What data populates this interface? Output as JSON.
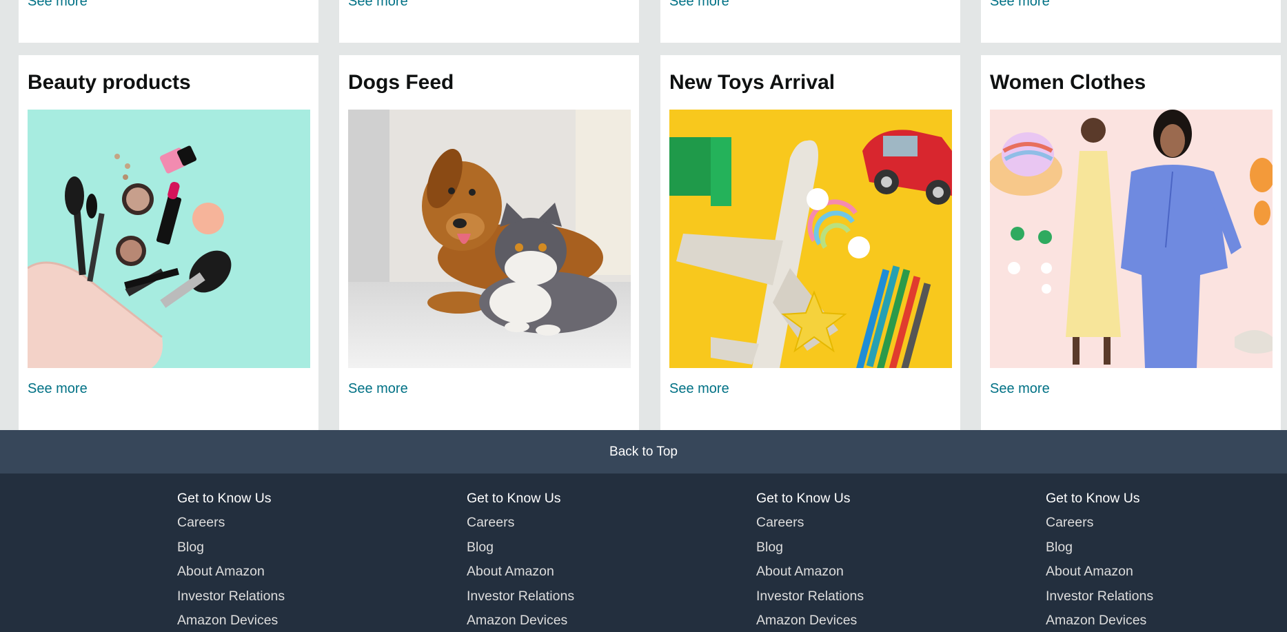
{
  "top_cards": [
    {
      "see_more": "See more"
    },
    {
      "see_more": "See more"
    },
    {
      "see_more": "See more"
    },
    {
      "see_more": "See more"
    }
  ],
  "cards": [
    {
      "title": "Beauty products",
      "see_more": "See more"
    },
    {
      "title": "Dogs Feed",
      "see_more": "See more"
    },
    {
      "title": "New Toys Arrival",
      "see_more": "See more"
    },
    {
      "title": "Women Clothes",
      "see_more": "See more"
    }
  ],
  "back_to_top": "Back to Top",
  "footer": {
    "columns": [
      {
        "heading": "Get to Know Us",
        "links": [
          "Careers",
          "Blog",
          "About Amazon",
          "Investor Relations",
          "Amazon Devices"
        ]
      },
      {
        "heading": "Get to Know Us",
        "links": [
          "Careers",
          "Blog",
          "About Amazon",
          "Investor Relations",
          "Amazon Devices"
        ]
      },
      {
        "heading": "Get to Know Us",
        "links": [
          "Careers",
          "Blog",
          "About Amazon",
          "Investor Relations",
          "Amazon Devices"
        ]
      },
      {
        "heading": "Get to Know Us",
        "links": [
          "Careers",
          "Blog",
          "About Amazon",
          "Investor Relations",
          "Amazon Devices"
        ]
      }
    ]
  },
  "colors": {
    "link": "#007185",
    "footer_bg": "#232f3e",
    "back_top_bg": "#37475a",
    "page_bg": "#e3e6e6"
  }
}
